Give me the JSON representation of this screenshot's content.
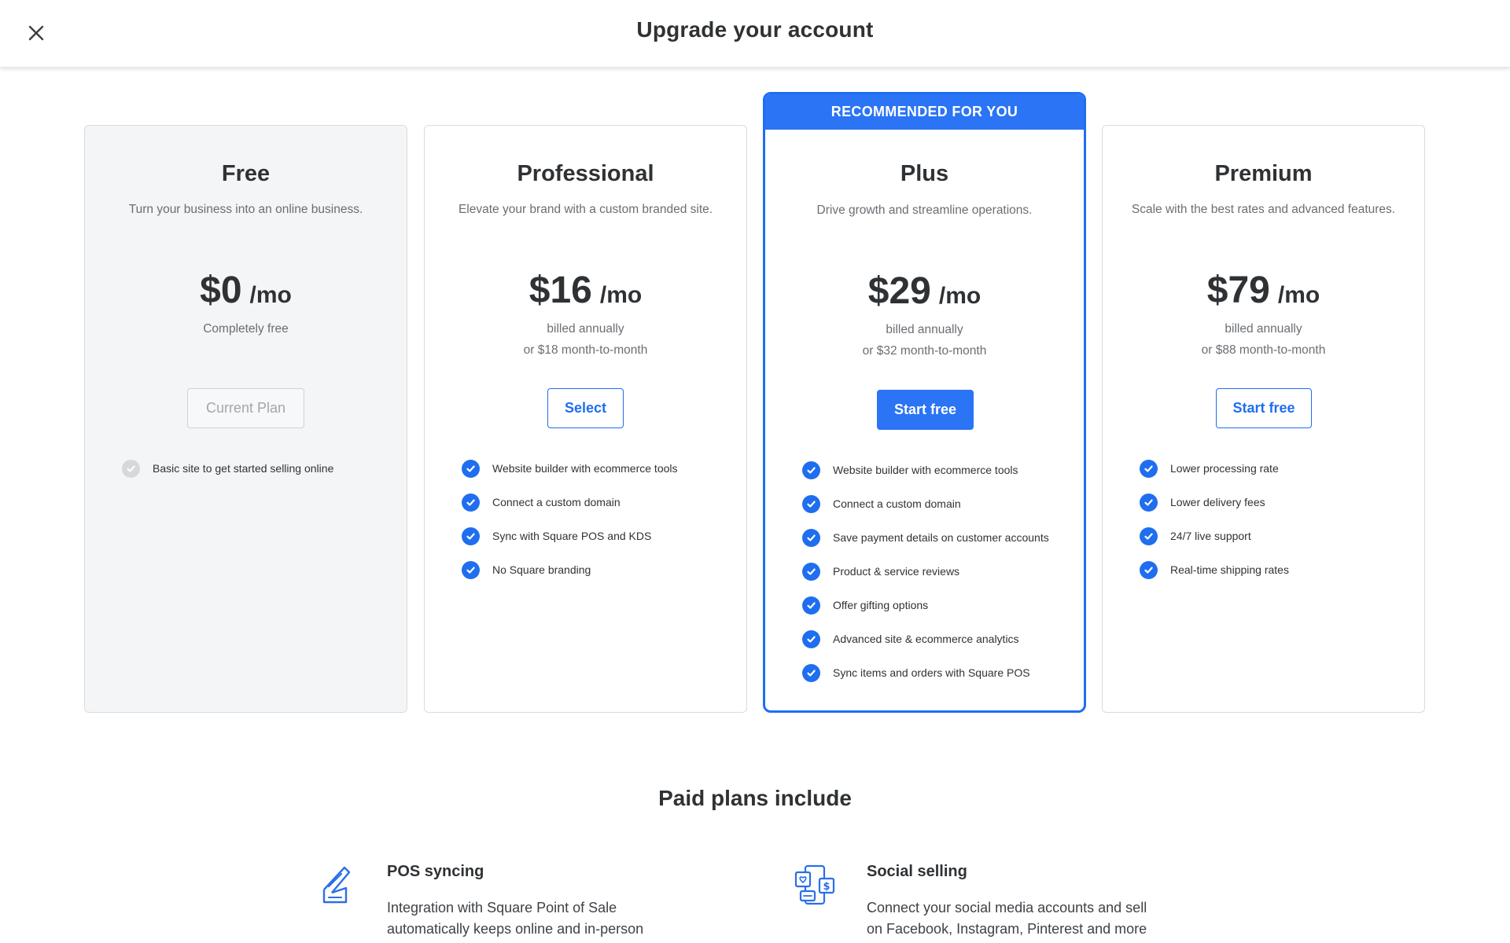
{
  "header": {
    "title": "Upgrade your account",
    "close_icon": "close-icon"
  },
  "colors": {
    "accent": "#1f6ef0",
    "banner": "#2a74f5",
    "free_card_bg": "#f4f5f6",
    "muted_text": "#6a6e73"
  },
  "plans": [
    {
      "name": "Free",
      "description": "Turn your business into an online business.",
      "price": "$0",
      "per": "/mo",
      "billing_line1": "Completely free",
      "billing_line2": "",
      "button": "Current Plan",
      "features": [
        "Basic site to get started selling online"
      ]
    },
    {
      "name": "Professional",
      "description": "Elevate your brand with a custom branded site.",
      "price": "$16",
      "per": "/mo",
      "billing_line1": "billed annually",
      "billing_line2": "or $18 month-to-month",
      "button": "Select",
      "features": [
        "Website builder with ecommerce tools",
        "Connect a custom domain",
        "Sync with Square POS and KDS",
        "No Square branding"
      ]
    },
    {
      "badge": "RECOMMENDED FOR YOU",
      "name": "Plus",
      "description": "Drive growth and streamline operations.",
      "price": "$29",
      "per": "/mo",
      "billing_line1": "billed annually",
      "billing_line2": "or $32 month-to-month",
      "button": "Start free",
      "features": [
        "Website builder with ecommerce tools",
        "Connect a custom domain",
        "Save payment details on customer accounts",
        "Product & service reviews",
        "Offer gifting options",
        "Advanced site & ecommerce analytics",
        "Sync items and orders with Square POS"
      ]
    },
    {
      "name": "Premium",
      "description": "Scale with the best rates and advanced features.",
      "price": "$79",
      "per": "/mo",
      "billing_line1": "billed annually",
      "billing_line2": "or $88 month-to-month",
      "button": "Start free",
      "features": [
        "Lower processing rate",
        "Lower delivery fees",
        "24/7 live support",
        "Real-time shipping rates"
      ]
    }
  ],
  "paid": {
    "title": "Paid plans include",
    "items": [
      {
        "icon": "pos-terminal-icon",
        "title": "POS syncing",
        "text": "Integration with Square Point of Sale automatically keeps online and in-person"
      },
      {
        "icon": "social-selling-icon",
        "title": "Social selling",
        "text": "Connect your social media accounts and sell on Facebook, Instagram, Pinterest and more"
      }
    ]
  }
}
